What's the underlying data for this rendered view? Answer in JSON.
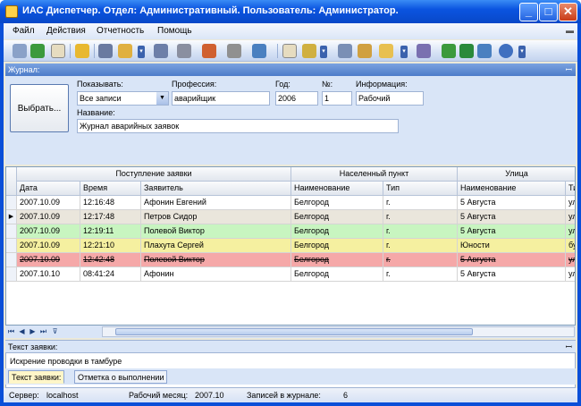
{
  "window": {
    "title": "ИАС Диспетчер. Отдел: Административный. Пользователь: Администратор."
  },
  "menu": [
    "Файл",
    "Действия",
    "Отчетность",
    "Помощь"
  ],
  "journal_panel": {
    "header": "Журнал:",
    "select_button": "Выбрать...",
    "show_label": "Показывать:",
    "show_value": "Все записи",
    "profession_label": "Профессия:",
    "profession_value": "аварийщик",
    "year_label": "Год:",
    "year_value": "2006",
    "number_label": "№:",
    "number_value": "1",
    "info_label": "Информация:",
    "info_value": "Рабочий",
    "name_label": "Название:",
    "name_value": "Журнал аварийных заявок"
  },
  "grid": {
    "bands": [
      "Поступление заявки",
      "Населенный пункт",
      "Улица"
    ],
    "columns": [
      "Дата",
      "Время",
      "Заявитель",
      "Наименование",
      "Тип",
      "Наименование",
      "Ти"
    ],
    "rows": [
      {
        "cells": [
          "2007.10.09",
          "12:16:48",
          "Афонин Евгений",
          "Белгород",
          "г.",
          "5 Августа",
          "ул"
        ],
        "color": "#ffffff",
        "strike": false
      },
      {
        "cells": [
          "2007.10.09",
          "12:17:48",
          "Петров Сидор",
          "Белгород",
          "г.",
          "5 Августа",
          "ул"
        ],
        "color": "#eae6dc",
        "strike": false
      },
      {
        "cells": [
          "2007.10.09",
          "12:19:11",
          "Полевой Виктор",
          "Белгород",
          "г.",
          "5 Августа",
          "ул"
        ],
        "color": "#c8f5c0",
        "strike": false
      },
      {
        "cells": [
          "2007.10.09",
          "12:21:10",
          "Плахута Сергей",
          "Белгород",
          "г.",
          "Юности",
          "бу"
        ],
        "color": "#f5f0a0",
        "strike": false
      },
      {
        "cells": [
          "2007.10.09",
          "12:42:48",
          "Полевой Виктор",
          "Белгород",
          "г.",
          "5 Августа",
          "ул"
        ],
        "color": "#f5a8a8",
        "strike": true
      },
      {
        "cells": [
          "2007.10.10",
          "08:41:24",
          "Афонин",
          "Белгород",
          "г.",
          "5 Августа",
          "ул"
        ],
        "color": "#ffffff",
        "strike": false
      }
    ]
  },
  "request_text": {
    "header": "Текст заявки:",
    "value": "Искрение проводки в тамбуре"
  },
  "tabs": [
    "Текст заявки:",
    "Отметка о выполнении"
  ],
  "status": {
    "server_label": "Сервер:",
    "server_value": "localhost",
    "month_label": "Рабочий месяц:",
    "month_value": "2007.10",
    "records_label": "Записей в журнале:",
    "records_value": "6"
  }
}
